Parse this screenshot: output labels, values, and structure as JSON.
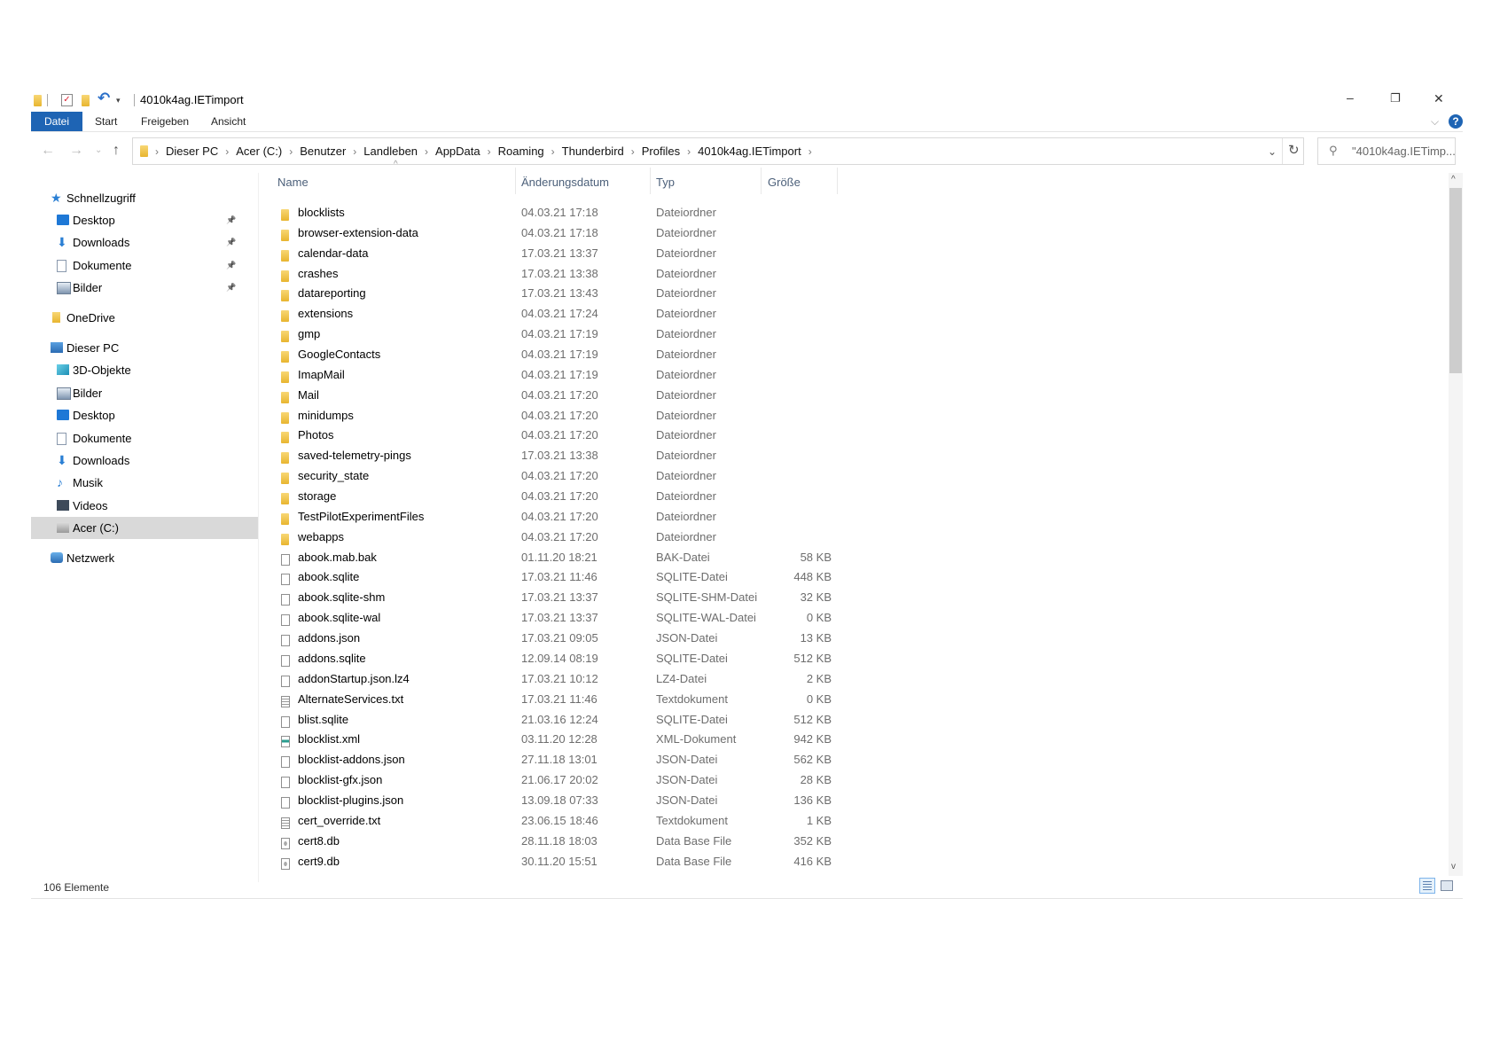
{
  "window": {
    "title": "4010k4ag.IETimport",
    "controls": {
      "minimize": "–",
      "restore": "❐",
      "close": "✕"
    }
  },
  "ribbon": {
    "tabs": [
      "Datei",
      "Start",
      "Freigeben",
      "Ansicht"
    ],
    "help": "?"
  },
  "address": {
    "crumbs": [
      "Dieser PC",
      "Acer (C:)",
      "Benutzer",
      "Landleben",
      "AppData",
      "Roaming",
      "Thunderbird",
      "Profiles",
      "4010k4ag.IETimport"
    ],
    "search_placeholder": "\"4010k4ag.IETimp..."
  },
  "sidebar": {
    "quick_access": {
      "label": "Schnellzugriff",
      "items": [
        "Desktop",
        "Downloads",
        "Dokumente",
        "Bilder"
      ]
    },
    "onedrive": "OneDrive",
    "this_pc": {
      "label": "Dieser PC",
      "items": [
        "3D-Objekte",
        "Bilder",
        "Desktop",
        "Dokumente",
        "Downloads",
        "Musik",
        "Videos",
        "Acer (C:)"
      ]
    },
    "network": "Netzwerk",
    "selected": "Acer (C:)"
  },
  "columns": {
    "name": "Name",
    "date": "Änderungsdatum",
    "type": "Typ",
    "size": "Größe"
  },
  "files": [
    {
      "name": "blocklists",
      "date": "04.03.21 17:18",
      "type": "Dateiordner",
      "size": "",
      "icon": "folder"
    },
    {
      "name": "browser-extension-data",
      "date": "04.03.21 17:18",
      "type": "Dateiordner",
      "size": "",
      "icon": "folder"
    },
    {
      "name": "calendar-data",
      "date": "17.03.21 13:37",
      "type": "Dateiordner",
      "size": "",
      "icon": "folder"
    },
    {
      "name": "crashes",
      "date": "17.03.21 13:38",
      "type": "Dateiordner",
      "size": "",
      "icon": "folder"
    },
    {
      "name": "datareporting",
      "date": "17.03.21 13:43",
      "type": "Dateiordner",
      "size": "",
      "icon": "folder"
    },
    {
      "name": "extensions",
      "date": "04.03.21 17:24",
      "type": "Dateiordner",
      "size": "",
      "icon": "folder"
    },
    {
      "name": "gmp",
      "date": "04.03.21 17:19",
      "type": "Dateiordner",
      "size": "",
      "icon": "folder"
    },
    {
      "name": "GoogleContacts",
      "date": "04.03.21 17:19",
      "type": "Dateiordner",
      "size": "",
      "icon": "folder"
    },
    {
      "name": "ImapMail",
      "date": "04.03.21 17:19",
      "type": "Dateiordner",
      "size": "",
      "icon": "folder"
    },
    {
      "name": "Mail",
      "date": "04.03.21 17:20",
      "type": "Dateiordner",
      "size": "",
      "icon": "folder"
    },
    {
      "name": "minidumps",
      "date": "04.03.21 17:20",
      "type": "Dateiordner",
      "size": "",
      "icon": "folder"
    },
    {
      "name": "Photos",
      "date": "04.03.21 17:20",
      "type": "Dateiordner",
      "size": "",
      "icon": "folder"
    },
    {
      "name": "saved-telemetry-pings",
      "date": "17.03.21 13:38",
      "type": "Dateiordner",
      "size": "",
      "icon": "folder"
    },
    {
      "name": "security_state",
      "date": "04.03.21 17:20",
      "type": "Dateiordner",
      "size": "",
      "icon": "folder"
    },
    {
      "name": "storage",
      "date": "04.03.21 17:20",
      "type": "Dateiordner",
      "size": "",
      "icon": "folder"
    },
    {
      "name": "TestPilotExperimentFiles",
      "date": "04.03.21 17:20",
      "type": "Dateiordner",
      "size": "",
      "icon": "folder"
    },
    {
      "name": "webapps",
      "date": "04.03.21 17:20",
      "type": "Dateiordner",
      "size": "",
      "icon": "folder"
    },
    {
      "name": "abook.mab.bak",
      "date": "01.11.20 18:21",
      "type": "BAK-Datei",
      "size": "58 KB",
      "icon": "file"
    },
    {
      "name": "abook.sqlite",
      "date": "17.03.21 11:46",
      "type": "SQLITE-Datei",
      "size": "448 KB",
      "icon": "file"
    },
    {
      "name": "abook.sqlite-shm",
      "date": "17.03.21 13:37",
      "type": "SQLITE-SHM-Datei",
      "size": "32 KB",
      "icon": "file"
    },
    {
      "name": "abook.sqlite-wal",
      "date": "17.03.21 13:37",
      "type": "SQLITE-WAL-Datei",
      "size": "0 KB",
      "icon": "file"
    },
    {
      "name": "addons.json",
      "date": "17.03.21 09:05",
      "type": "JSON-Datei",
      "size": "13 KB",
      "icon": "file"
    },
    {
      "name": "addons.sqlite",
      "date": "12.09.14 08:19",
      "type": "SQLITE-Datei",
      "size": "512 KB",
      "icon": "file"
    },
    {
      "name": "addonStartup.json.lz4",
      "date": "17.03.21 10:12",
      "type": "LZ4-Datei",
      "size": "2 KB",
      "icon": "file"
    },
    {
      "name": "AlternateServices.txt",
      "date": "17.03.21 11:46",
      "type": "Textdokument",
      "size": "0 KB",
      "icon": "text"
    },
    {
      "name": "blist.sqlite",
      "date": "21.03.16 12:24",
      "type": "SQLITE-Datei",
      "size": "512 KB",
      "icon": "file"
    },
    {
      "name": "blocklist.xml",
      "date": "03.11.20 12:28",
      "type": "XML-Dokument",
      "size": "942 KB",
      "icon": "xml"
    },
    {
      "name": "blocklist-addons.json",
      "date": "27.11.18 13:01",
      "type": "JSON-Datei",
      "size": "562 KB",
      "icon": "file"
    },
    {
      "name": "blocklist-gfx.json",
      "date": "21.06.17 20:02",
      "type": "JSON-Datei",
      "size": "28 KB",
      "icon": "file"
    },
    {
      "name": "blocklist-plugins.json",
      "date": "13.09.18 07:33",
      "type": "JSON-Datei",
      "size": "136 KB",
      "icon": "file"
    },
    {
      "name": "cert_override.txt",
      "date": "23.06.15 18:46",
      "type": "Textdokument",
      "size": "1 KB",
      "icon": "text"
    },
    {
      "name": "cert8.db",
      "date": "28.11.18 18:03",
      "type": "Data Base File",
      "size": "352 KB",
      "icon": "db"
    },
    {
      "name": "cert9.db",
      "date": "30.11.20 15:51",
      "type": "Data Base File",
      "size": "416 KB",
      "icon": "db"
    }
  ],
  "status": {
    "count": "106 Elemente"
  },
  "colors": {
    "accent": "#1e64b4",
    "selected_bg": "#d9d9d9",
    "header_text": "#4c607a"
  }
}
